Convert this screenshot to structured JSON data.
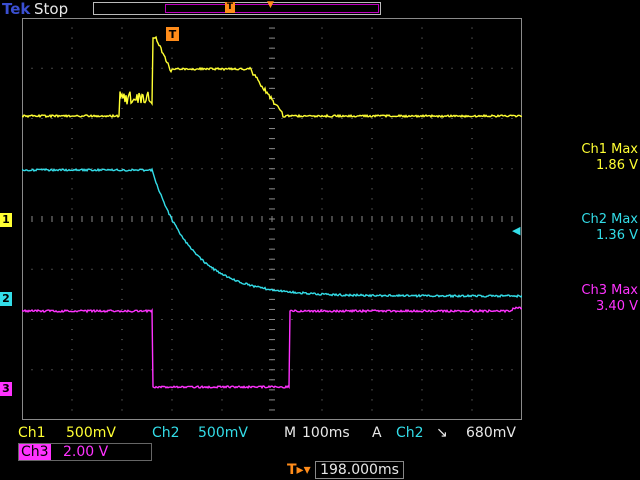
{
  "header": {
    "brand": "Tek",
    "run_state": "Stop",
    "record_marker": "T"
  },
  "scope": {
    "trigger_marker": "T",
    "channel_markers": [
      "1",
      "2",
      "3"
    ]
  },
  "measurements": [
    {
      "label": "Ch1 Max",
      "value": "1.86 V"
    },
    {
      "label": "Ch2 Max",
      "value": "1.36 V"
    },
    {
      "label": "Ch3 Max",
      "value": "3.40 V"
    }
  ],
  "bottom": {
    "ch1_label": "Ch1",
    "ch1_scale": "500mV",
    "ch2_label": "Ch2",
    "ch2_scale": "500mV",
    "timebase_label": "M",
    "timebase": "100ms",
    "trigger_mode": "A",
    "trigger_source": "Ch2",
    "trigger_slope": "↘",
    "trigger_level": "680mV",
    "ch3_label": "Ch3",
    "ch3_scale": "2.00 V",
    "trigger_position": "198.000ms"
  },
  "colors": {
    "ch1": "#ffff33",
    "ch2": "#33dde8",
    "ch3": "#ff33ff",
    "trigger": "#ff8c1a",
    "grid": "#8a8a8a"
  }
}
